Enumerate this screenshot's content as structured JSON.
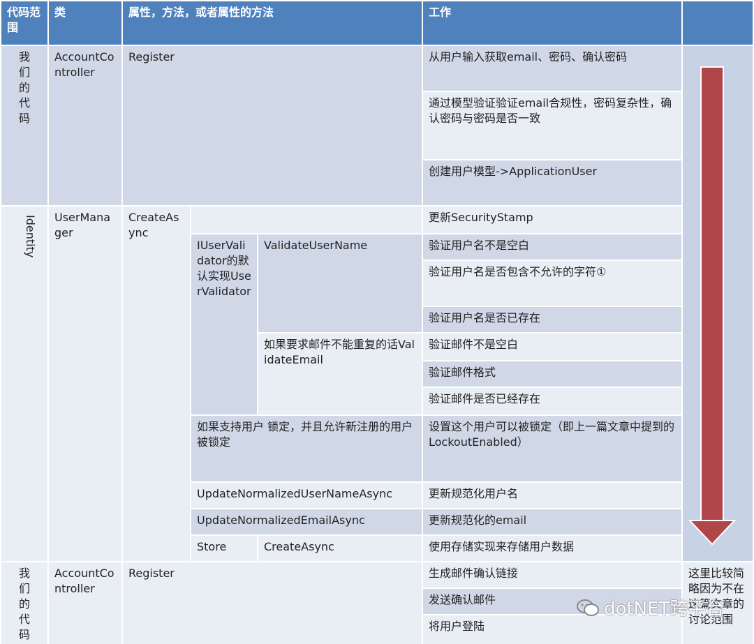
{
  "header": {
    "scope": "代码范围",
    "class": "类",
    "member": "属性，方法，或者属性的方法",
    "work": "工作"
  },
  "rows": {
    "ours_top": {
      "scope": "我们的代码",
      "class": "AccountController",
      "member": "Register",
      "work": [
        "从用户输入获取email、密码、确认密码",
        "通过模型验证验证email合规性，密码复杂性，确认密码与密码是否一致",
        "创建用户模型->ApplicationUser"
      ]
    },
    "identity": {
      "scope": "Identity",
      "class": "UserManager",
      "member": "CreateAsync",
      "security_stamp": "更新SecurityStamp",
      "validator_label": "IUserValidator的默认实现UserValidator",
      "validate_username": "ValidateUserName",
      "username_work": [
        "验证用户名不是空白",
        "验证用户名是否包含不允许的字符①",
        "验证用户名是否已存在"
      ],
      "validate_email": "如果要求邮件不能重复的话ValidateEmail",
      "email_work": [
        "验证邮件不是空白",
        "验证邮件格式",
        "验证邮件是否已经存在"
      ],
      "lockout_condition": "如果支持用户 锁定，并且允许新注册的用户被锁定",
      "lockout_work": "设置这个用户可以被锁定（即上一篇文章中提到的LockoutEnabled）",
      "normalize_username": "UpdateNormalizedUserNameAsync",
      "normalize_username_work": "更新规范化用户名",
      "normalize_email": "UpdateNormalizedEmailAsync",
      "normalize_email_work": "更新规范化的email",
      "store": "Store",
      "store_create": "CreateAsync",
      "store_work": "使用存储实现来存储用户数据"
    },
    "ours_bottom": {
      "scope": "我们的代码",
      "class": "AccountController",
      "member": "Register",
      "work": [
        "生成邮件确认链接",
        "发送确认邮件",
        "将用户登陆"
      ],
      "note": "这里比较简略因为不在这篇文章的讨论范围"
    }
  },
  "watermark": "dotNET跨平台",
  "colors": {
    "header": "#4f81bd",
    "band_dark": "#d0d8e8",
    "band_light": "#e9edf4",
    "arrow": "#b0464a"
  }
}
